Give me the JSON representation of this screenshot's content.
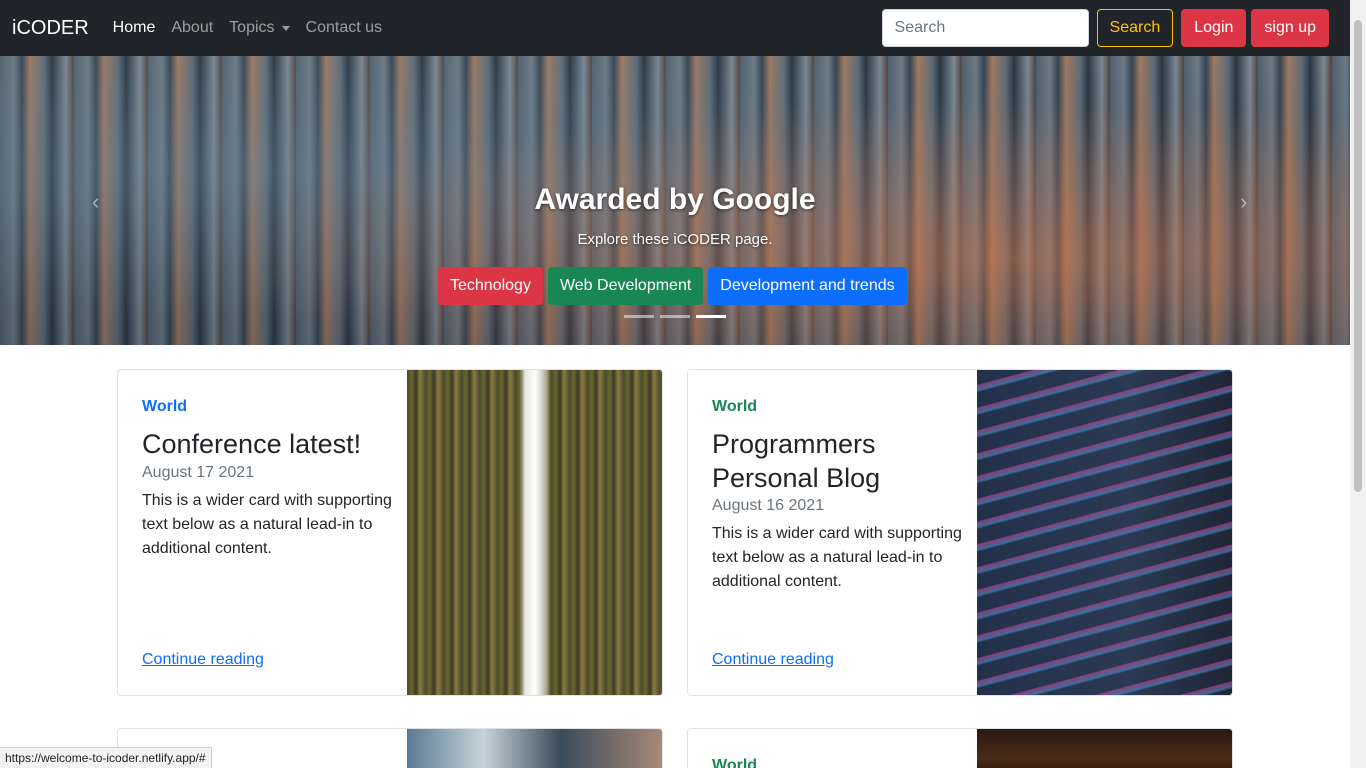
{
  "navbar": {
    "brand": "iCODER",
    "links": [
      {
        "label": "Home"
      },
      {
        "label": "About"
      },
      {
        "label": "Topics"
      },
      {
        "label": "Contact us"
      }
    ],
    "search_placeholder": "Search",
    "search_button": "Search",
    "login_button": "Login",
    "signup_button": "sign up"
  },
  "hero": {
    "title": "Awarded by Google",
    "subtitle": "Explore these iCODER page.",
    "buttons": [
      {
        "label": "Technology",
        "color": "#dc3545"
      },
      {
        "label": "Web Development",
        "color": "#198754"
      },
      {
        "label": "Development and trends",
        "color": "#0d6efd"
      }
    ],
    "active_slide": 3,
    "slide_count": 3
  },
  "cards": [
    {
      "category": "World",
      "category_color": "#0d6efd",
      "title": "Conference latest!",
      "date": "August 17 2021",
      "text": "This is a wider card with supporting text below as a natural lead-in to additional content.",
      "link": "Continue reading"
    },
    {
      "category": "World",
      "category_color": "#198754",
      "title": "Programmers Personal Blog",
      "date": "August 16 2021",
      "text": "This is a wider card with supporting text below as a natural lead-in to additional content.",
      "link": "Continue reading"
    },
    {
      "category": "",
      "category_color": "#0d6efd"
    },
    {
      "category": "World",
      "category_color": "#198754"
    }
  ],
  "statusbar": {
    "url": "https://welcome-to-icoder.netlify.app/#"
  }
}
